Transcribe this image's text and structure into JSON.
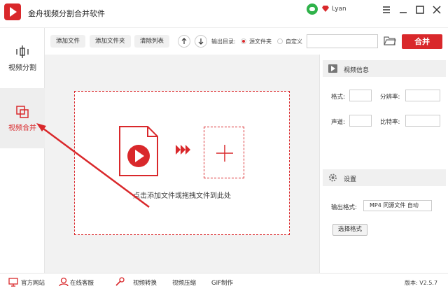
{
  "app": {
    "title": "金舟视频分割合并软件"
  },
  "user": {
    "name": "Lyan"
  },
  "sidebar": {
    "items": [
      {
        "label": "视频分割",
        "active": false
      },
      {
        "label": "视频合并",
        "active": true
      }
    ]
  },
  "toolbar": {
    "add_file": "添加文件",
    "add_folder": "添加文件夹",
    "clear_list": "清除列表",
    "output_dir_label": "输出目录:",
    "radio_source": "源文件夹",
    "radio_custom": "自定义",
    "path_value": "",
    "merge_label": "合并"
  },
  "main": {
    "hint": "点击添加文件或拖拽文件到此处"
  },
  "video_info": {
    "title": "视频信息",
    "format_label": "格式:",
    "resolution_label": "分辨率:",
    "channel_label": "声道:",
    "bitrate_label": "比特率:"
  },
  "settings": {
    "title": "设置",
    "output_format_label": "输出格式:",
    "output_format_value": "MP4 同源文件 自动",
    "choose_format": "选择格式"
  },
  "bottom": {
    "website": "官方网站",
    "support": "在线客服",
    "convert": "视频转换",
    "compress": "视频压缩",
    "gif": "GIF制作",
    "version": "版本: V2.5.7"
  },
  "colors": {
    "accent": "#d9282b"
  }
}
